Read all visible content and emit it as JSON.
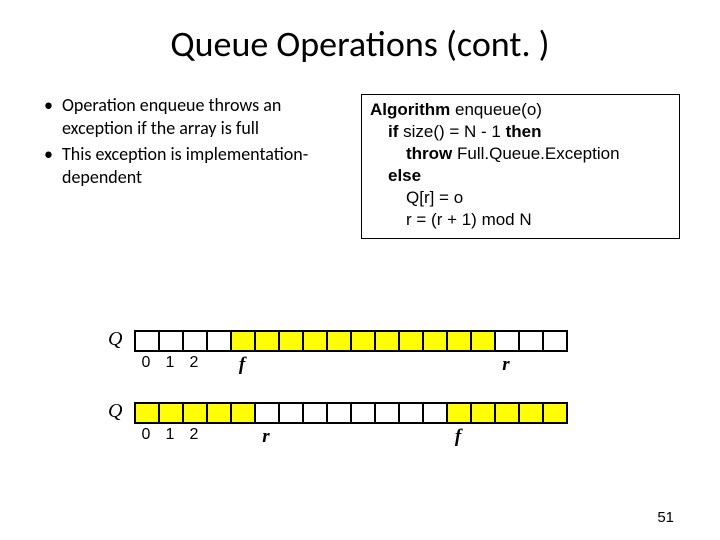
{
  "title": "Queue Operations (cont. )",
  "bullets": [
    "Operation enqueue throws an exception if the array is full",
    "This exception is implementation-dependent"
  ],
  "algorithm": {
    "l0_a": "Algorithm",
    "l0_b": " enqueue(o)",
    "l1_a": "if",
    "l1_b": " size() = N - 1 ",
    "l1_c": "then",
    "l2_a": "throw",
    "l2_b": " Full.Queue.Exception",
    "l3": "else",
    "l4": "Q[r] = o",
    "l5": "r = (r + 1) mod N"
  },
  "diagrams": {
    "label": "Q",
    "indices": [
      "0",
      "1",
      "2"
    ],
    "pointers": {
      "f": "f",
      "r": "r"
    }
  },
  "chart_data": [
    {
      "type": "array-diagram",
      "label": "Q",
      "cells": 18,
      "filled_indices_range": [
        4,
        14
      ],
      "pointer_f_index": 4,
      "pointer_r_index": 15,
      "visible_indices": [
        0,
        1,
        2
      ]
    },
    {
      "type": "array-diagram",
      "label": "Q",
      "cells": 18,
      "filled_indices": [
        0,
        1,
        2,
        3,
        4,
        13,
        14,
        15,
        16,
        17
      ],
      "pointer_r_index": 5,
      "pointer_f_index": 13,
      "visible_indices": [
        0,
        1,
        2
      ]
    }
  ],
  "page_number": "51"
}
